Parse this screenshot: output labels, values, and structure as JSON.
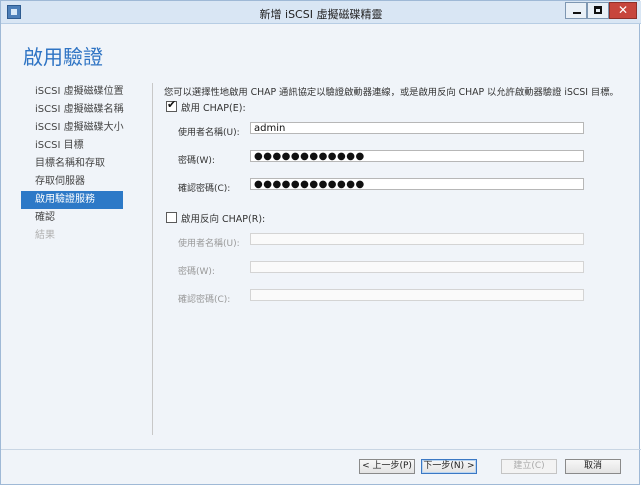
{
  "window": {
    "title": "新增 iSCSI 虛擬磁碟精靈",
    "minimize_glyph": "",
    "maximize_glyph": "",
    "close_glyph": "✕"
  },
  "page_title": "啟用驗證",
  "nav": {
    "items": [
      {
        "label": "iSCSI 虛擬磁碟位置",
        "state": "normal"
      },
      {
        "label": "iSCSI 虛擬磁碟名稱",
        "state": "normal"
      },
      {
        "label": "iSCSI 虛擬磁碟大小",
        "state": "normal"
      },
      {
        "label": "iSCSI 目標",
        "state": "normal"
      },
      {
        "label": "目標名稱和存取",
        "state": "normal"
      },
      {
        "label": "存取伺服器",
        "state": "normal"
      },
      {
        "label": "啟用驗證服務",
        "state": "active"
      },
      {
        "label": "確認",
        "state": "normal"
      },
      {
        "label": "結果",
        "state": "disabled"
      }
    ]
  },
  "content": {
    "description": "您可以選擇性地啟用 CHAP 通訊協定以驗證啟動器連線，或是啟用反向 CHAP 以允許啟動器驗證 iSCSI 目標。",
    "chap": {
      "checkbox_label": "啟用 CHAP(E):",
      "checked": true,
      "username_label": "使用者名稱(U):",
      "username_value": "admin",
      "password_label": "密碼(W):",
      "password_value": "●●●●●●●●●●●●",
      "confirm_label": "確認密碼(C):",
      "confirm_value": "●●●●●●●●●●●●"
    },
    "reverse_chap": {
      "checkbox_label": "啟用反向 CHAP(R):",
      "checked": false,
      "username_label": "使用者名稱(U):",
      "username_value": "",
      "password_label": "密碼(W):",
      "password_value": "",
      "confirm_label": "確認密碼(C):",
      "confirm_value": ""
    }
  },
  "footer": {
    "prev_label": "< 上一步(P)",
    "next_label": "下一步(N) >",
    "create_label": "建立(C)",
    "cancel_label": "取消"
  },
  "colors": {
    "accent": "#2d79c7",
    "title": "#2f74c4",
    "window_bg": "#f0f4f9"
  }
}
